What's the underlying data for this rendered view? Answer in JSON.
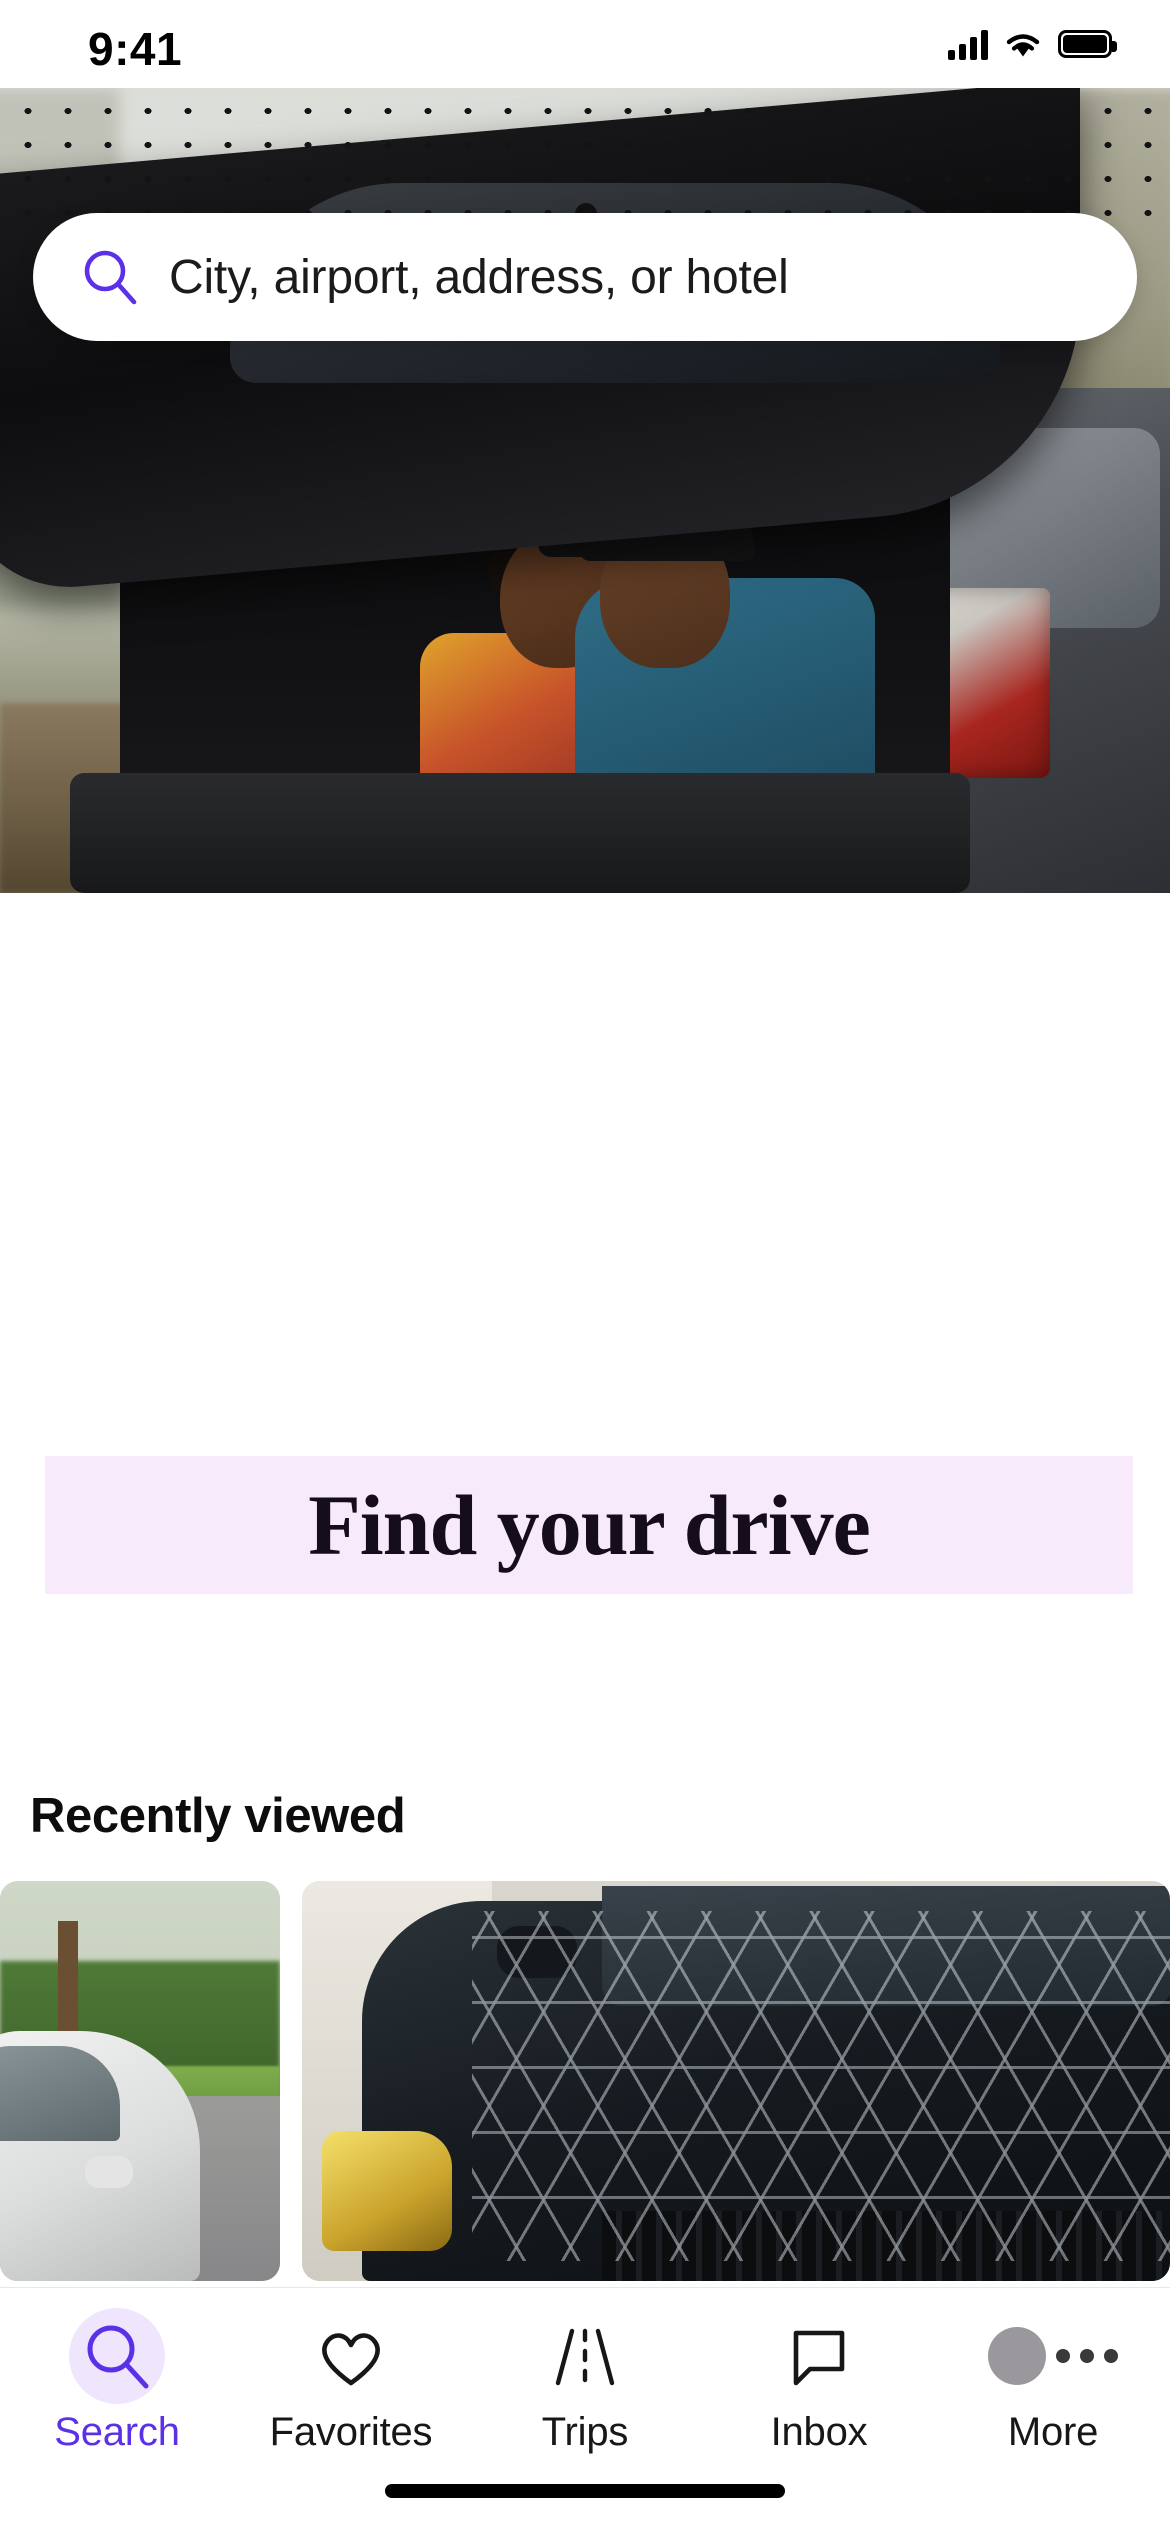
{
  "status_bar": {
    "time": "9:41",
    "cellular_icon": "signal-bars-icon",
    "wifi_icon": "wifi-icon",
    "battery_icon": "battery-full-icon"
  },
  "search": {
    "icon": "search-icon",
    "placeholder": "City, airport, address, or hotel",
    "value": ""
  },
  "hero": {
    "alt": "Couple sitting in the open trunk of an SUV",
    "overlay_pattern": "polka-dot-overlay"
  },
  "banner": {
    "title": "Find your drive",
    "background_color": "#F7EAFB",
    "text_color": "#150D1C"
  },
  "recently_viewed": {
    "title": "Recently viewed",
    "cards": [
      {
        "alt": "White sedan parked on the street near green hedges"
      },
      {
        "alt": "Black car hood with hexagonal light reflections"
      }
    ]
  },
  "tab_bar": {
    "active": "Search",
    "accent_color": "#5B31E8",
    "items": [
      {
        "label": "Search",
        "icon": "search-icon",
        "active": true
      },
      {
        "label": "Favorites",
        "icon": "heart-icon",
        "active": false
      },
      {
        "label": "Trips",
        "icon": "road-icon",
        "active": false
      },
      {
        "label": "Inbox",
        "icon": "chat-bubble-icon",
        "active": false
      },
      {
        "label": "More",
        "icon": "avatar-more-icon",
        "active": false
      }
    ]
  },
  "home_indicator": {
    "icon": "home-indicator"
  }
}
